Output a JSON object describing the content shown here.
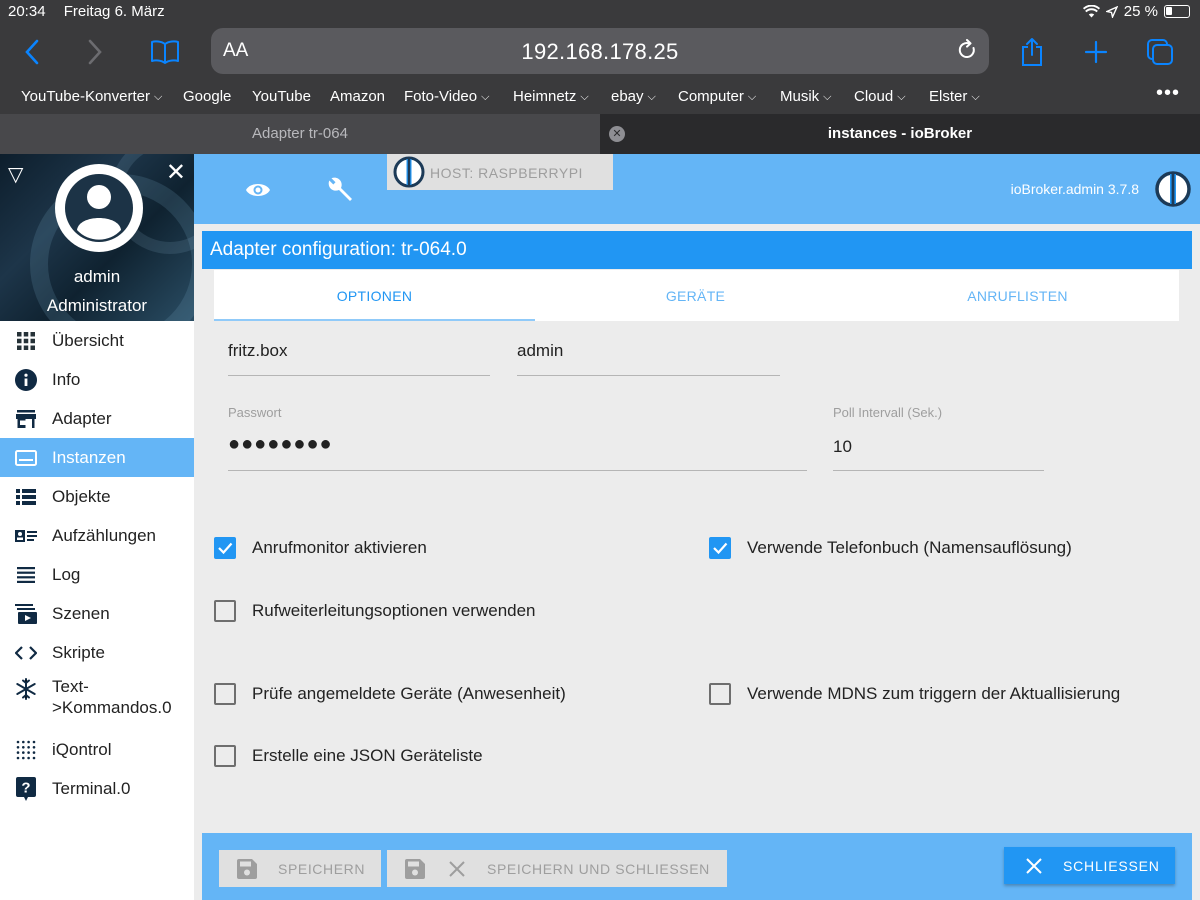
{
  "statusbar": {
    "time": "20:34",
    "date": "Freitag 6. März",
    "battery": "25 %"
  },
  "browser": {
    "text_size_label": "AA",
    "url": "192.168.178.25",
    "bookmarks": [
      {
        "label": "YouTube-Konverter",
        "menu": true
      },
      {
        "label": "Google",
        "menu": false
      },
      {
        "label": "YouTube",
        "menu": false
      },
      {
        "label": "Amazon",
        "menu": false
      },
      {
        "label": "Foto-Video",
        "menu": true
      },
      {
        "label": "Heimnetz",
        "menu": true
      },
      {
        "label": "ebay",
        "menu": true
      },
      {
        "label": "Computer",
        "menu": true
      },
      {
        "label": "Musik",
        "menu": true
      },
      {
        "label": "Cloud",
        "menu": true
      },
      {
        "label": "Elster",
        "menu": true
      }
    ],
    "tabs": [
      {
        "title": "Adapter tr-064",
        "active": false
      },
      {
        "title": "instances - ioBroker",
        "active": true
      }
    ]
  },
  "sidebar": {
    "username": "admin",
    "role": "Administrator",
    "items": [
      {
        "label": "Übersicht",
        "icon": "grid-icon",
        "active": false
      },
      {
        "label": "Info",
        "icon": "info-icon",
        "active": false
      },
      {
        "label": "Adapter",
        "icon": "store-icon",
        "active": false
      },
      {
        "label": "Instanzen",
        "icon": "instances-icon",
        "active": true
      },
      {
        "label": "Objekte",
        "icon": "list-icon",
        "active": false
      },
      {
        "label": "Aufzählungen",
        "icon": "enum-icon",
        "active": false
      },
      {
        "label": "Log",
        "icon": "log-icon",
        "active": false
      },
      {
        "label": "Szenen",
        "icon": "scene-icon",
        "active": false
      },
      {
        "label": "Skripte",
        "icon": "code-icon",
        "active": false
      },
      {
        "label": "Text->Kommandos.0",
        "icon": "snowflake-icon",
        "active": false
      },
      {
        "label": "iQontrol",
        "icon": "dots-grid-icon",
        "active": false
      },
      {
        "label": "Terminal.0",
        "icon": "help-icon",
        "active": false
      }
    ]
  },
  "header": {
    "host_label": "HOST: RASPBERRYPI",
    "admin_version": "ioBroker.admin 3.7.8"
  },
  "config": {
    "title": "Adapter configuration: tr-064.0",
    "tabs": [
      "OPTIONEN",
      "GERÄTE",
      "ANRUFLISTEN"
    ],
    "active_tab": 0,
    "fields": {
      "host_value": "fritz.box",
      "user_value": "admin",
      "password_label": "Passwort",
      "password_value": "●●●●●●●●",
      "poll_label": "Poll Intervall (Sek.)",
      "poll_value": "10"
    },
    "checkboxes": [
      {
        "label": "Anrufmonitor aktivieren",
        "checked": true
      },
      {
        "label": "Verwende Telefonbuch (Namensauflösung)",
        "checked": true
      },
      {
        "label": "Rufweiterleitungsoptionen verwenden",
        "checked": false
      },
      {
        "label": "Prüfe angemeldete Geräte (Anwesenheit)",
        "checked": false
      },
      {
        "label": "Verwende MDNS zum triggern der Aktuallisierung",
        "checked": false
      },
      {
        "label": "Erstelle eine JSON Geräteliste",
        "checked": false
      }
    ]
  },
  "footer": {
    "save_label": "SPEICHERN",
    "save_close_label": "SPEICHERN UND SCHLIESSEN",
    "close_label": "SCHLIESSEN"
  },
  "colors": {
    "primary": "#2196f3",
    "header": "#64b5f6",
    "browser_chrome": "#3a3a3c",
    "ios_blue": "#0a84ff"
  }
}
